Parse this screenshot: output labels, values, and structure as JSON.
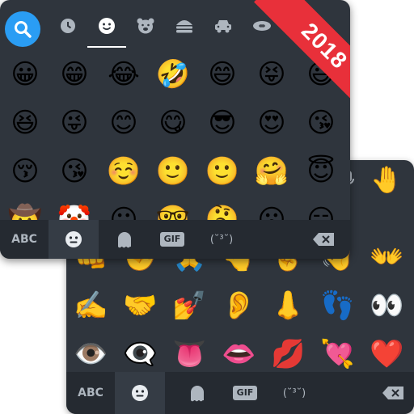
{
  "badge": {
    "text": "2018"
  },
  "colors": {
    "keyboard_bg": "#2f353d",
    "bar_bg": "#252a31",
    "accent": "#2a9df4",
    "ribbon": "#e8303a"
  },
  "front": {
    "tabs": [
      "search-icon",
      "recent-clock-icon",
      "smiley-icon",
      "bear-icon",
      "burger-icon",
      "car-icon",
      "football-icon"
    ],
    "rows": [
      [
        "😀",
        "😁",
        "😂",
        "🤣",
        "😄",
        "😝",
        "😃"
      ],
      [
        "😆",
        "😜",
        "😊",
        "😋",
        "😎",
        "😍",
        "😘"
      ],
      [
        "😚",
        "😘",
        "☺️",
        "🙂",
        "🙂",
        "🤗",
        "😇"
      ],
      [
        "🤠",
        "🤡",
        "😐",
        "🤓",
        "🤔",
        "😮",
        "😑"
      ]
    ],
    "bottom": {
      "abc": "ABC",
      "gif": "GIF",
      "kaomoji": "(˘³˘)"
    }
  },
  "back": {
    "rows": [
      [
        "👊",
        "✊",
        "🙏",
        "👆",
        "🤞",
        "👋",
        "👐"
      ],
      [
        "✍️",
        "🤝",
        "💅",
        "👂",
        "👃",
        "👣",
        "👀"
      ],
      [
        "👁️",
        "👁️‍🗨️",
        "👅",
        "👄",
        "💋",
        "💘",
        "❤️"
      ]
    ],
    "topright": [
      "🤚"
    ],
    "bottom": {
      "abc": "ABC",
      "gif": "GIF",
      "kaomoji": "(˘³˘)"
    }
  }
}
